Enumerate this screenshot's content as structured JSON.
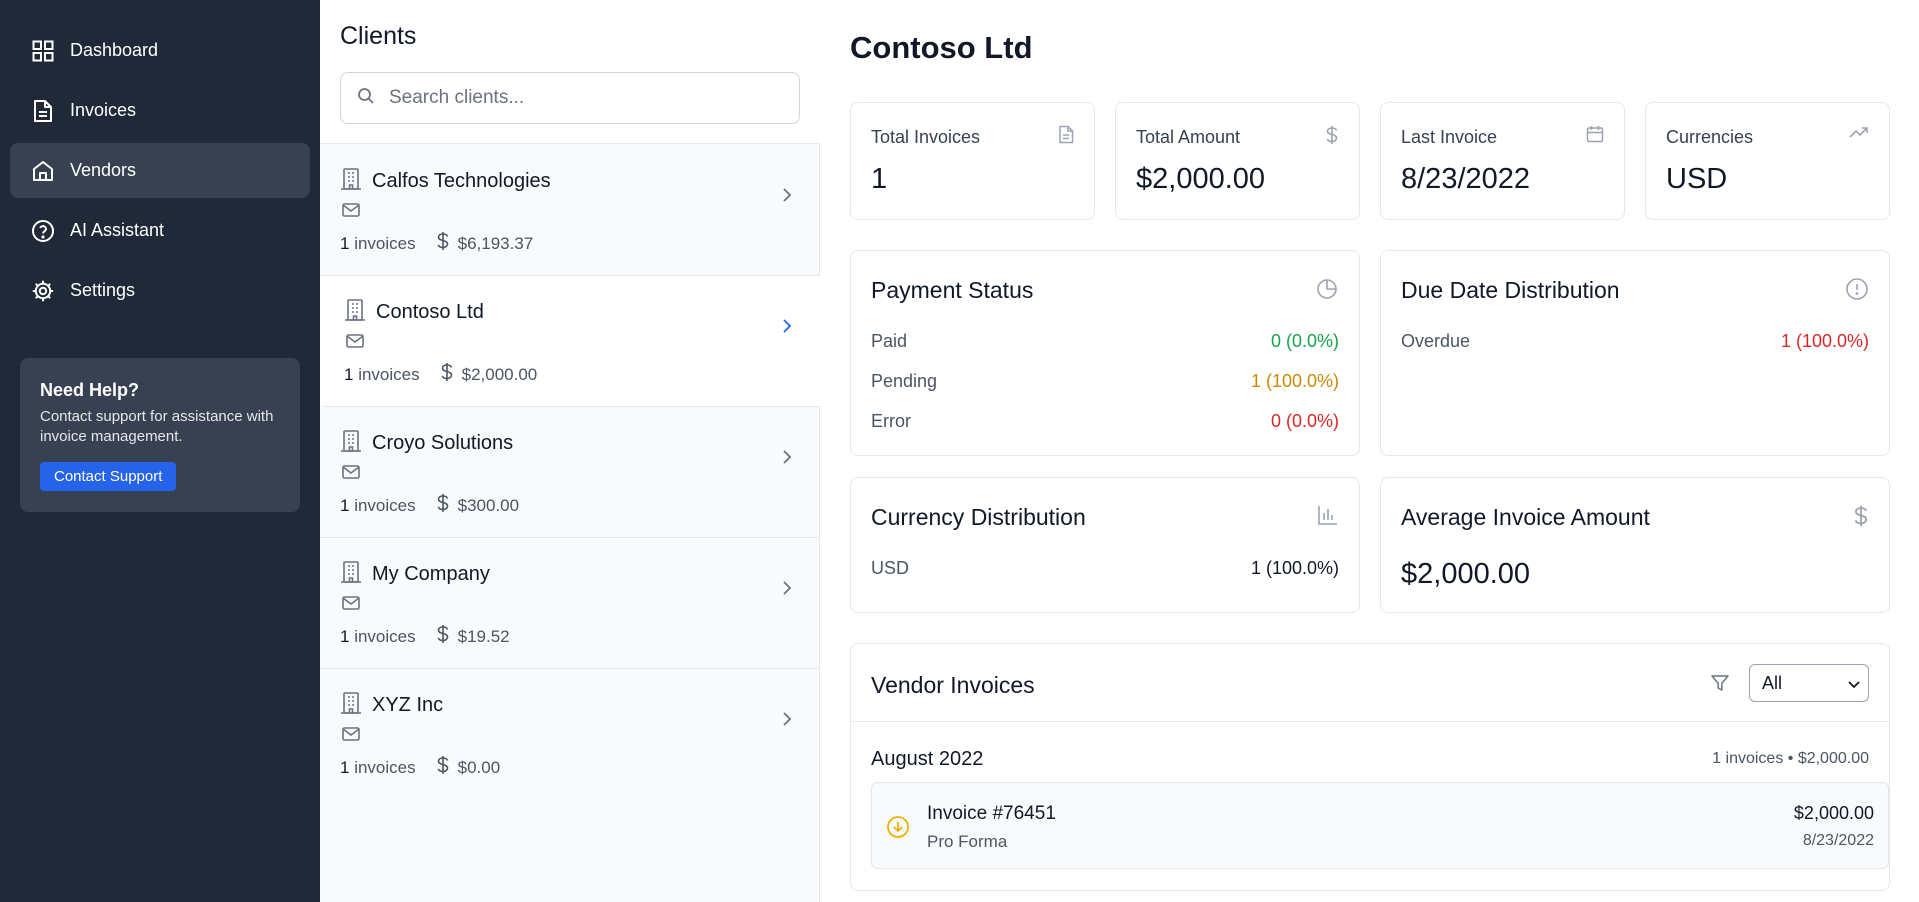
{
  "nav": [
    {
      "label": "Dashboard",
      "icon": "grid-icon"
    },
    {
      "label": "Invoices",
      "icon": "document-icon"
    },
    {
      "label": "Vendors",
      "icon": "home-icon"
    },
    {
      "label": "AI Assistant",
      "icon": "help-circle-icon"
    },
    {
      "label": "Settings",
      "icon": "gear-icon"
    }
  ],
  "help": {
    "title": "Need Help?",
    "text": "Contact support for assistance with invoice management.",
    "button": "Contact Support"
  },
  "clients": {
    "title": "Clients",
    "search_placeholder": "Search clients...",
    "items": [
      {
        "name": "Calfos Technologies",
        "count": "1",
        "count_label": "invoices",
        "amount": "$6,193.37"
      },
      {
        "name": "Contoso Ltd",
        "count": "1",
        "count_label": "invoices",
        "amount": "$2,000.00"
      },
      {
        "name": "Croyo Solutions",
        "count": "1",
        "count_label": "invoices",
        "amount": "$300.00"
      },
      {
        "name": "My Company",
        "count": "1",
        "count_label": "invoices",
        "amount": "$19.52"
      },
      {
        "name": "XYZ Inc",
        "count": "1",
        "count_label": "invoices",
        "amount": "$0.00"
      }
    ]
  },
  "main": {
    "title": "Contoso Ltd",
    "stats": [
      {
        "label": "Total Invoices",
        "value": "1",
        "icon": "document-icon"
      },
      {
        "label": "Total Amount",
        "value": "$2,000.00",
        "icon": "dollar-icon"
      },
      {
        "label": "Last Invoice",
        "value": "8/23/2022",
        "icon": "calendar-icon"
      },
      {
        "label": "Currencies",
        "value": "USD",
        "icon": "trending-up-icon"
      }
    ],
    "payment_status": {
      "title": "Payment Status",
      "rows": [
        {
          "label": "Paid",
          "value": "0 (0.0%)",
          "color": "#16a34a"
        },
        {
          "label": "Pending",
          "value": "1 (100.0%)",
          "color": "#ca8a04"
        },
        {
          "label": "Error",
          "value": "0 (0.0%)",
          "color": "#dc2626"
        }
      ]
    },
    "due_date": {
      "title": "Due Date Distribution",
      "rows": [
        {
          "label": "Overdue",
          "value": "1 (100.0%)",
          "color": "#dc2626"
        }
      ]
    },
    "currency_dist": {
      "title": "Currency Distribution",
      "rows": [
        {
          "label": "USD",
          "value": "1 (100.0%)"
        }
      ]
    },
    "average": {
      "title": "Average Invoice Amount",
      "value": "$2,000.00"
    },
    "vendor_invoices": {
      "title": "Vendor Invoices",
      "filter_value": "All",
      "month": "August 2022",
      "month_summary": "1 invoices • $2,000.00",
      "invoice": {
        "number": "Invoice #76451",
        "type": "Pro Forma",
        "amount": "$2,000.00",
        "date": "8/23/2022"
      }
    }
  },
  "colors": {
    "sidebar_bg": "#1f2937",
    "accent": "#2563eb",
    "paid": "#16a34a",
    "pending": "#ca8a04",
    "error": "#dc2626"
  }
}
